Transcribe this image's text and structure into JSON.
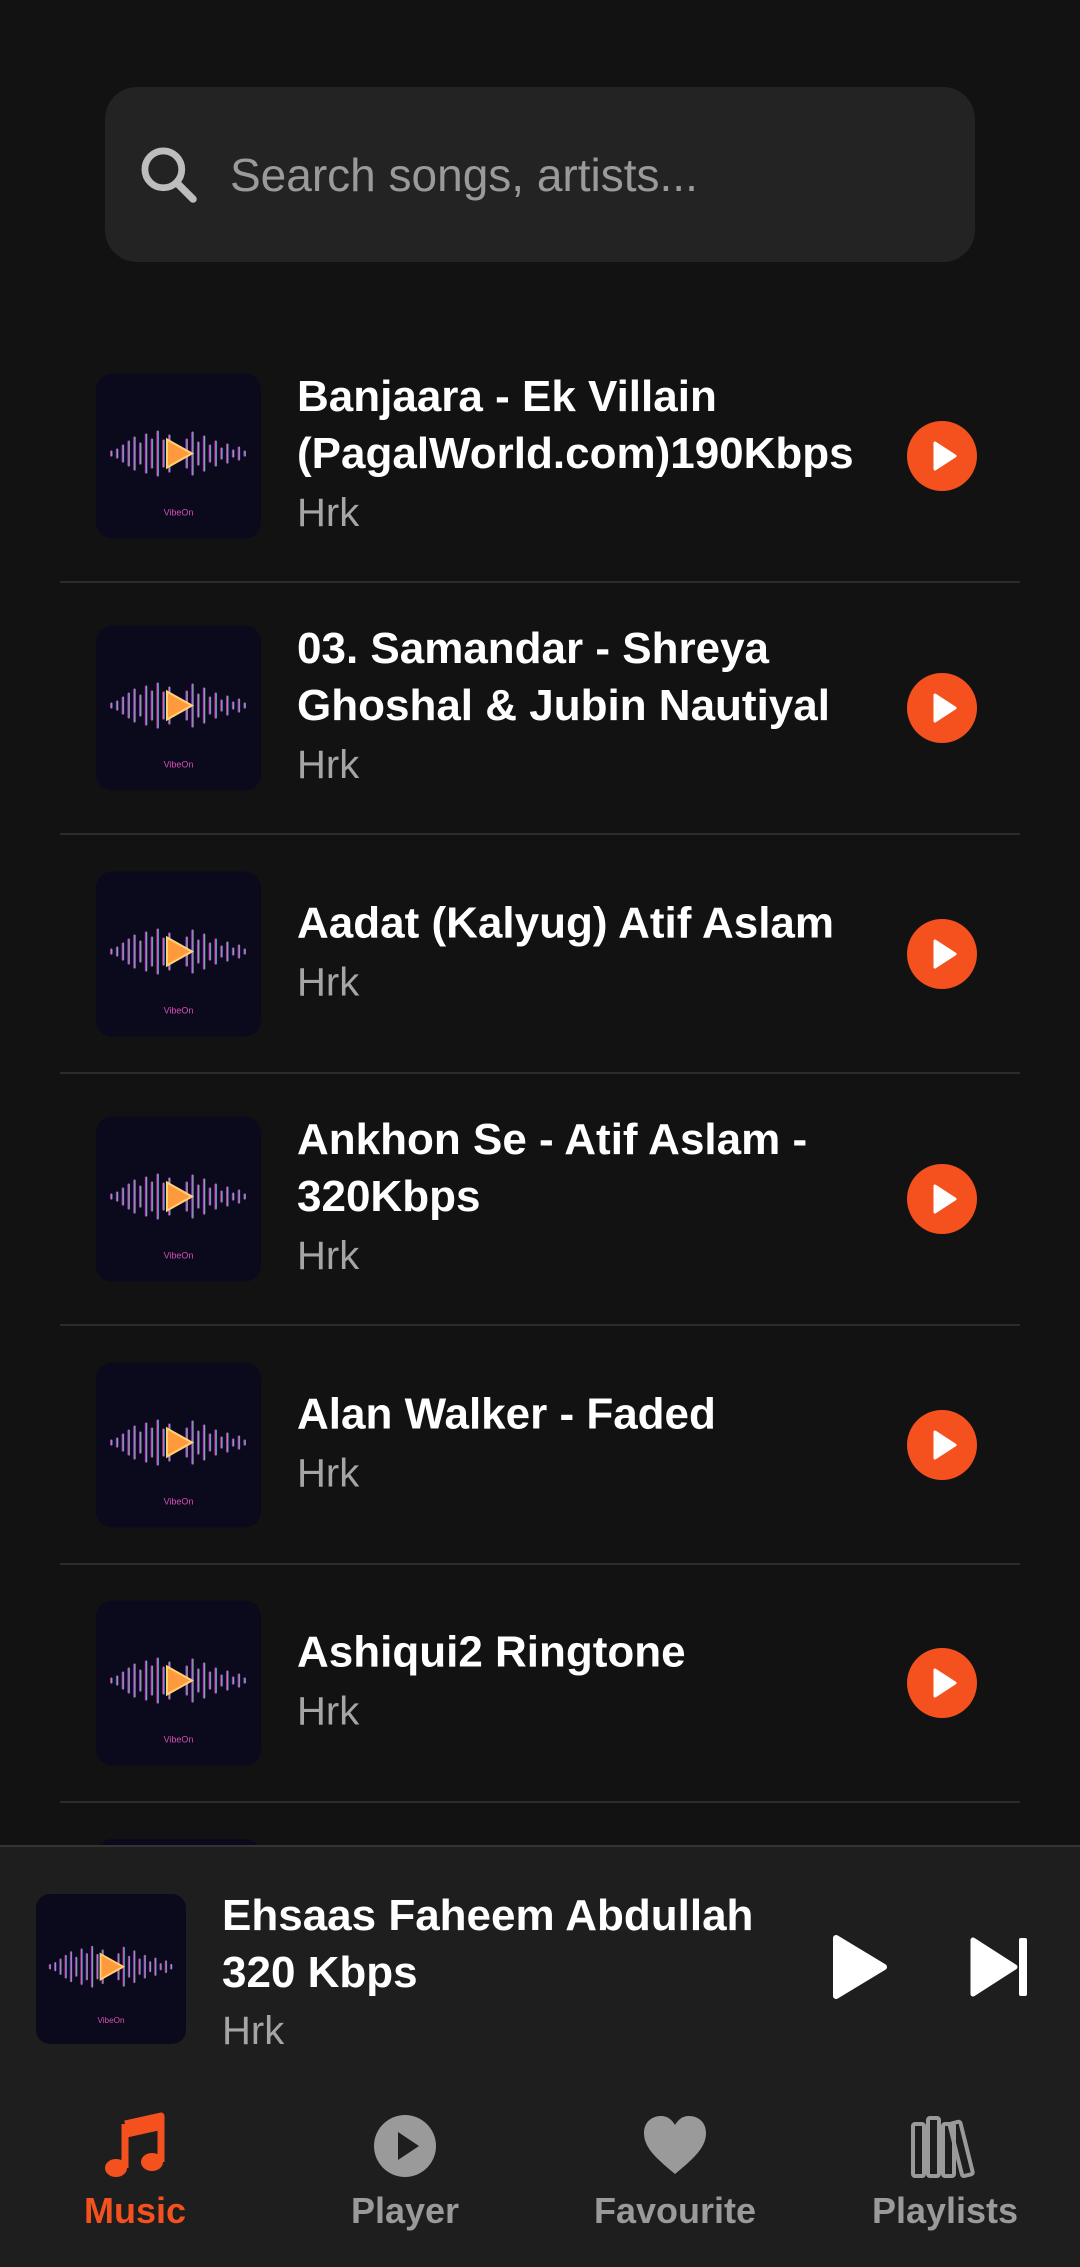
{
  "search": {
    "placeholder": "Search songs, artists..."
  },
  "colors": {
    "accent": "#f4511e",
    "background": "#121212",
    "surface": "#1e1e1e"
  },
  "songs": [
    {
      "title": "Banjaara - Ek Villain (PagalWorld.com)190Kbps",
      "artist": "Hrk"
    },
    {
      "title": "03. Samandar - Shreya Ghoshal & Jubin Nautiyal",
      "artist": "Hrk"
    },
    {
      "title": "Aadat (Kalyug) Atif Aslam",
      "artist": "Hrk"
    },
    {
      "title": "Ankhon Se - Atif Aslam - 320Kbps",
      "artist": "Hrk"
    },
    {
      "title": "Alan Walker - Faded",
      "artist": "Hrk"
    },
    {
      "title": "Ashiqui2 Ringtone",
      "artist": "Hrk"
    }
  ],
  "album_art_text": "VibeOn",
  "now_playing": {
    "title": "Ehsaas Faheem Abdullah 320 Kbps",
    "artist": "Hrk"
  },
  "nav": {
    "items": [
      {
        "label": "Music",
        "icon": "music-note-icon",
        "active": true
      },
      {
        "label": "Player",
        "icon": "play-circle-icon",
        "active": false
      },
      {
        "label": "Favourite",
        "icon": "heart-icon",
        "active": false
      },
      {
        "label": "Playlists",
        "icon": "library-icon",
        "active": false
      }
    ]
  }
}
